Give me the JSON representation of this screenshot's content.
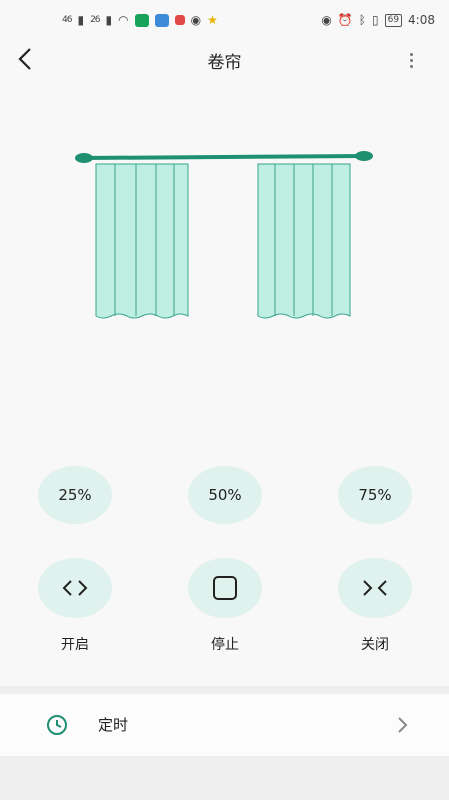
{
  "status_bar": {
    "signal_1": "46",
    "signal_2": "26",
    "battery": "69",
    "time": "4:08"
  },
  "header": {
    "title": "卷帘"
  },
  "presets": [
    {
      "label": "25%"
    },
    {
      "label": "50%"
    },
    {
      "label": "75%"
    }
  ],
  "controls": {
    "open_label": "开启",
    "stop_label": "停止",
    "close_label": "关闭"
  },
  "timer": {
    "label": "定时"
  },
  "colors": {
    "accent": "#1f8f72",
    "chip_bg": "#dff2ee",
    "curtain_fill": "#bfeee3"
  }
}
